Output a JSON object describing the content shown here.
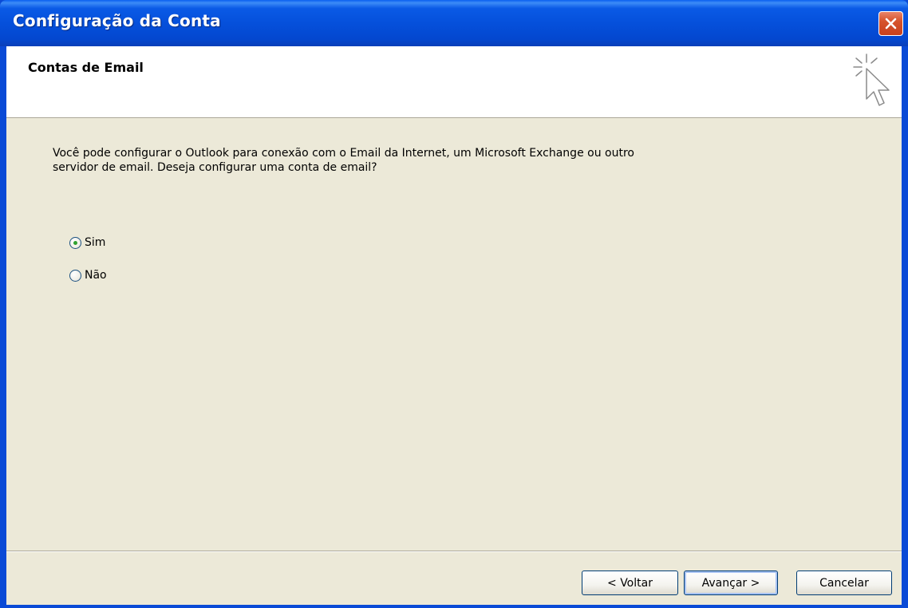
{
  "window": {
    "title": "Configuração da Conta"
  },
  "header": {
    "title": "Contas de Email",
    "icon": "wizard-sparkle-cursor-icon"
  },
  "main": {
    "description": "Você pode configurar o Outlook para conexão com o Email da Internet, um Microsoft Exchange ou outro servidor de email. Deseja configurar uma conta de email?",
    "options": [
      {
        "label": "Sim",
        "checked": true
      },
      {
        "label": "Não",
        "checked": false
      }
    ]
  },
  "footer": {
    "back_label": "< Voltar",
    "next_label": "Avançar >",
    "cancel_label": "Cancelar"
  },
  "colors": {
    "titlebar": "#0550db",
    "dialog_bg": "#ece9d8",
    "radio_dot": "#2fa12f"
  }
}
